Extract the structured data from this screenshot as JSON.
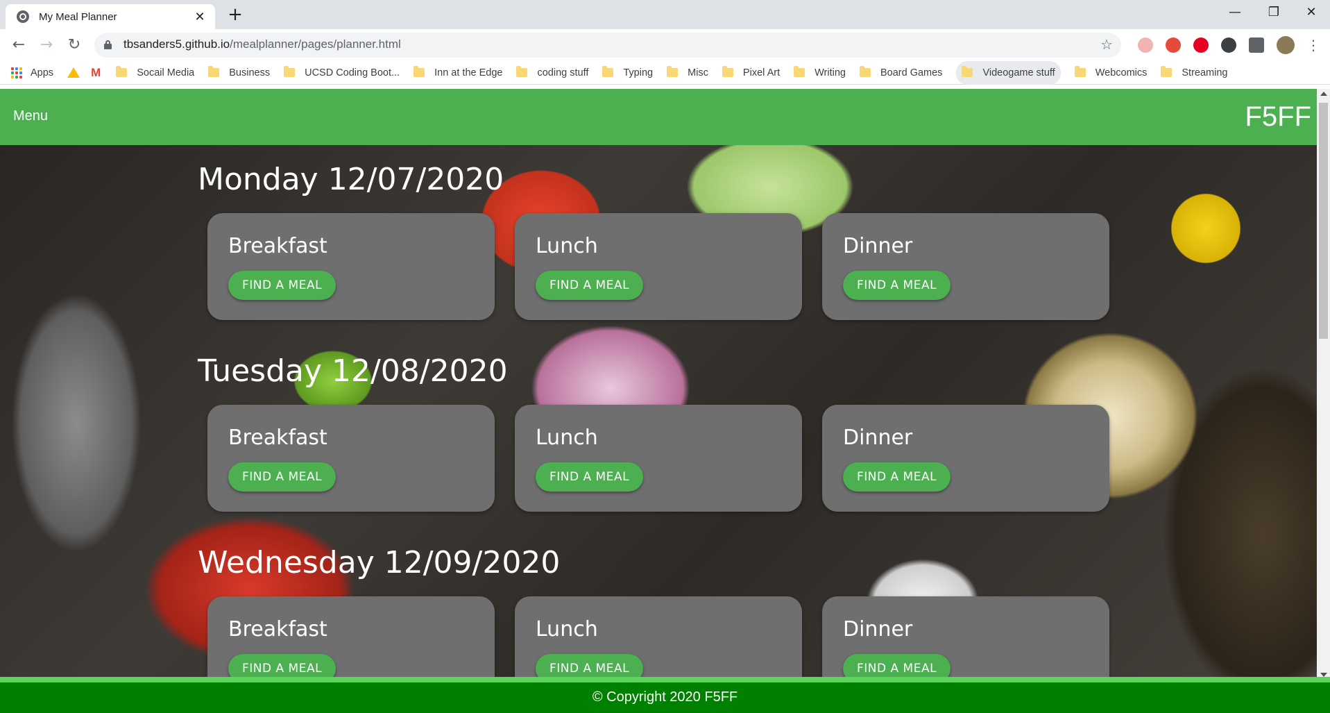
{
  "browser": {
    "tab_title": "My Meal Planner",
    "tab_close": "✕",
    "new_tab": "+",
    "window_minimize": "—",
    "window_restore": "❐",
    "window_close": "✕",
    "url_host": "tbsanders5.github.io",
    "url_path": "/mealplanner/pages/planner.html"
  },
  "bookmarks": [
    "Apps",
    "Socail Media",
    "Business",
    "UCSD Coding Boot...",
    "Inn at the Edge",
    "coding stuff",
    "Typing",
    "Misc",
    "Pixel Art",
    "Writing",
    "Board Games",
    "Videogame stuff",
    "Webcomics",
    "Streaming"
  ],
  "navbar": {
    "menu_label": "Menu",
    "brand": "F5FF"
  },
  "days": [
    {
      "title": "Monday 12/07/2020",
      "meals": [
        "Breakfast",
        "Lunch",
        "Dinner"
      ]
    },
    {
      "title": "Tuesday 12/08/2020",
      "meals": [
        "Breakfast",
        "Lunch",
        "Dinner"
      ]
    },
    {
      "title": "Wednesday 12/09/2020",
      "meals": [
        "Breakfast",
        "Lunch",
        "Dinner"
      ]
    }
  ],
  "button_label": "FIND A MEAL",
  "footer": "© Copyright 2020 F5FF",
  "colors": {
    "navbar": "#4caf50",
    "card": "#6f6f6f",
    "button": "#4caf50",
    "footer": "#008000",
    "footer_border": "#5bd65b"
  }
}
